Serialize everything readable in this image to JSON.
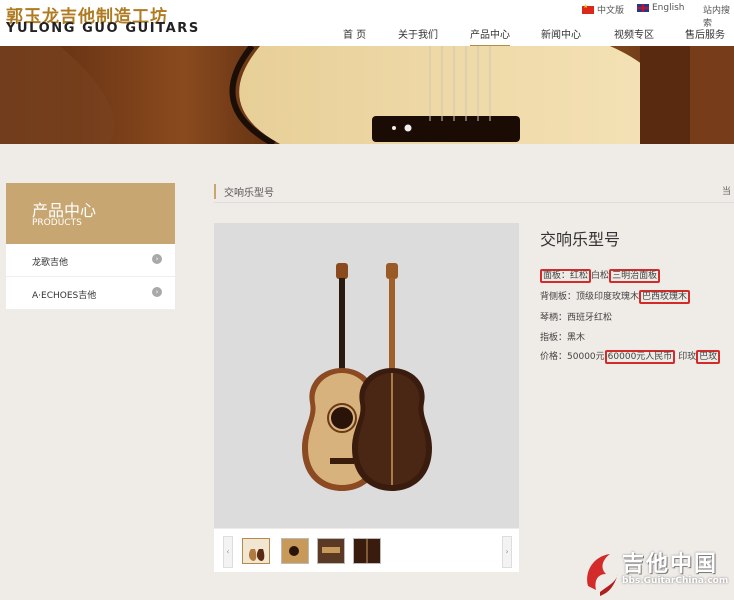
{
  "header": {
    "logo_cn": "郭玉龙吉他制造工坊",
    "logo_en": "YULONG GUO GUITARS",
    "lang_cn": "中文版",
    "lang_en": "English",
    "site_search": "站内搜索"
  },
  "nav": {
    "items": [
      "首 页",
      "关于我们",
      "产品中心",
      "新闻中心",
      "视频专区",
      "售后服务"
    ],
    "active": "产品中心"
  },
  "sidebar": {
    "title": "产品中心",
    "subtitle": "PRODUCTS",
    "items": [
      {
        "label": "龙歌吉他"
      },
      {
        "label": "A·ECHOES吉他"
      }
    ]
  },
  "breadcrumb": {
    "current": "交响乐型号",
    "right_text": "当"
  },
  "product": {
    "title": "交响乐型号",
    "specs": {
      "top_label": "面板",
      "top_value": "红松",
      "top_text": "白松",
      "top_sub": "三明治面板",
      "back_label": "背侧板",
      "back_value": "顶级印度玫瑰木",
      "back_alt": "巴西玫瑰木",
      "neck_label": "琴柄",
      "neck_value": "西班牙红松",
      "fret_label": "指板",
      "fret_value": "黑木",
      "price_label": "价格",
      "price_value": "50000元",
      "price_alt": "60000元人民币",
      "price_suffix": "印玫",
      "price_alt2": "巴玫"
    },
    "thumbnail_count": 4
  },
  "watermark": {
    "text_cn": "吉他中国",
    "url": "bbs.GuitarChina.com"
  },
  "colors": {
    "accent": "#c8a672",
    "highlight_box": "#d32a2a",
    "background": "#efebe7"
  }
}
